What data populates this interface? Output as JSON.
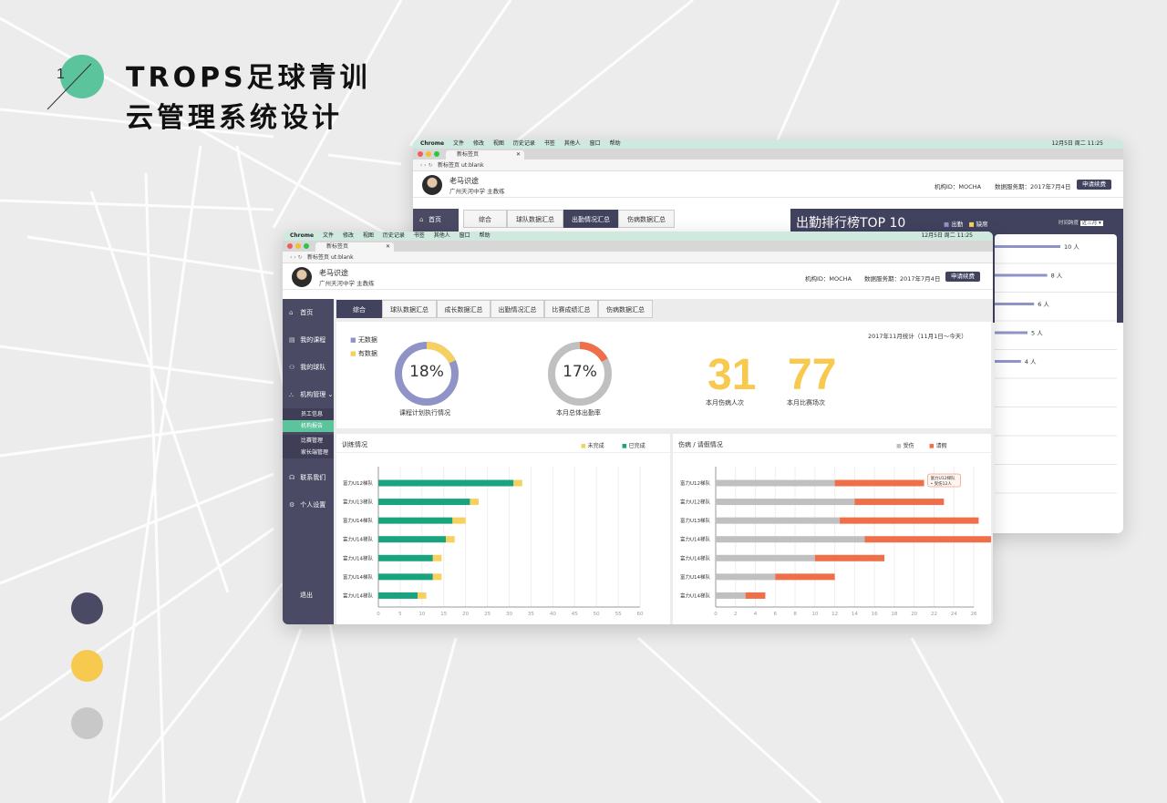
{
  "page": {
    "number": "1",
    "title_line1": "TROPS足球青训",
    "title_line2": "云管理系统设计",
    "dots": [
      "#4b4a64",
      "#f7c94e",
      "#c8c8c8"
    ]
  },
  "browser": {
    "menubar": [
      "Chrome",
      "文件",
      "修改",
      "视图",
      "历史记录",
      "书签",
      "其他人",
      "窗口",
      "帮助"
    ],
    "time": "12月5日 周二 11:25",
    "tab_title": "新标签页",
    "url_prefix": "新标签页",
    "url": "ut:blank"
  },
  "header": {
    "user_name": "老马识途",
    "user_org": "广州天河中学 主教练",
    "org_id": "机构ID：MOCHA",
    "service": "数据服务期：2017年7月4日",
    "renew_button": "申请续费"
  },
  "sidebar": {
    "items": [
      {
        "icon": "home-icon",
        "glyph": "⌂",
        "label": "首页"
      },
      {
        "icon": "book-icon",
        "glyph": "▤",
        "label": "我的课程"
      },
      {
        "icon": "team-icon",
        "glyph": "⚇",
        "label": "我的球队"
      },
      {
        "icon": "org-icon",
        "glyph": "⛬",
        "label": "机构管理 ⌄"
      }
    ],
    "subitems": [
      "员工信息",
      "机构报告"
    ],
    "subitems2": [
      "比赛管理",
      "家长端管理"
    ],
    "items2": [
      {
        "icon": "headset-icon",
        "glyph": "☊",
        "label": "联系我们"
      },
      {
        "icon": "gear-icon",
        "glyph": "⚙",
        "label": "个人设置"
      }
    ],
    "logout": "退出"
  },
  "tabs": [
    "综合",
    "球队数据汇总",
    "成长数据汇总",
    "出勤情况汇总",
    "比赛成绩汇总",
    "伤病数据汇总"
  ],
  "back_tabs": [
    "综合",
    "球队数据汇总",
    "出勤情况汇总",
    "伤病数据汇总"
  ],
  "summary": {
    "period": "2017年11月统计（11月1日～今天）",
    "legend": [
      "无数据",
      "有数据"
    ],
    "ring1": {
      "value": "18%",
      "label": "课程计划执行情况",
      "fraction": 0.18
    },
    "ring2": {
      "value": "17%",
      "label": "本月总体出勤率",
      "fraction": 0.17
    },
    "injuries": {
      "value": "31",
      "label": "本月伤病人次"
    },
    "matches": {
      "value": "77",
      "label": "本月比赛场次"
    }
  },
  "colors": {
    "dark": "#41425e",
    "green": "#1aa37f",
    "yellow": "#f7d160",
    "purple": "#9093c6",
    "gray": "#c0c0c0",
    "orange": "#ee6f4a",
    "teal": "#5cc49c"
  },
  "chart_data": [
    {
      "type": "bar",
      "title": "训练情况",
      "orientation": "horizontal",
      "stacked": true,
      "categories": [
        "富力U12梯队",
        "富力U13梯队",
        "富力U14梯队",
        "富力U14梯队",
        "富力U14梯队",
        "富力U14梯队",
        "富力U14梯队"
      ],
      "series": [
        {
          "name": "已完成",
          "color": "#1aa37f",
          "values": [
            31,
            21,
            17,
            15.5,
            12.5,
            12.5,
            9
          ]
        },
        {
          "name": "未完成",
          "color": "#f7d160",
          "values": [
            2,
            2,
            3,
            2,
            2,
            2,
            2
          ]
        }
      ],
      "ticks": [
        0,
        5,
        10,
        15,
        20,
        25,
        30,
        35,
        40,
        45,
        50,
        55,
        60
      ],
      "xlim": [
        0,
        60
      ],
      "legend_position": "top-right"
    },
    {
      "type": "bar",
      "title": "伤病 / 请假情况",
      "orientation": "horizontal",
      "stacked": true,
      "categories": [
        "富力U12梯队",
        "富力U12梯队",
        "富力U13梯队",
        "富力U14梯队",
        "富力U14梯队",
        "富力U14梯队",
        "富力U14梯队"
      ],
      "series": [
        {
          "name": "受伤",
          "color": "#c0c0c0",
          "values": [
            12,
            14,
            12.5,
            15,
            10,
            6,
            3
          ]
        },
        {
          "name": "请假",
          "color": "#ee6f4a",
          "values": [
            9,
            9,
            14,
            17.5,
            7,
            6,
            2
          ]
        }
      ],
      "ticks": [
        0,
        2,
        4,
        6,
        8,
        10,
        12,
        14,
        16,
        18,
        20,
        22,
        24,
        26
      ],
      "xlim": [
        0,
        26
      ],
      "tooltip": [
        "富力U12梯队",
        "• 受伤12人"
      ],
      "legend_position": "top-right"
    },
    {
      "type": "bar",
      "title": "出勤排行榜TOP 10",
      "orientation": "horizontal",
      "categories": [
        "",
        "",
        "",
        "",
        ""
      ],
      "values": [
        10,
        8,
        6,
        5,
        4
      ],
      "value_labels": [
        "10 人",
        "8 人",
        "6 人",
        "5 人",
        "4 人"
      ],
      "legend": [
        "出勤",
        "缺席"
      ],
      "period_label": "时间跨度",
      "period_value": "近三月 ▾"
    }
  ]
}
